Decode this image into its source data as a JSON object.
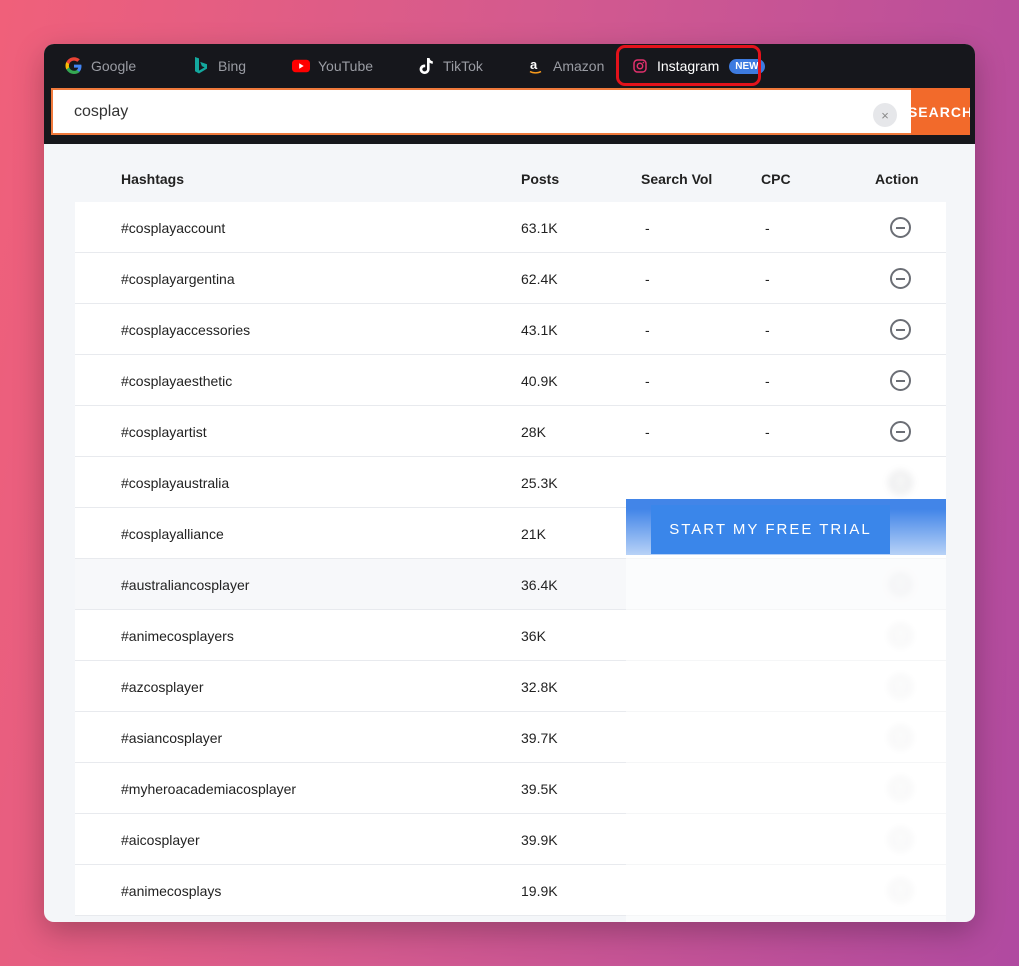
{
  "tabs": [
    {
      "label": "Google",
      "icon": "google-icon"
    },
    {
      "label": "Bing",
      "icon": "bing-icon"
    },
    {
      "label": "YouTube",
      "icon": "youtube-icon"
    },
    {
      "label": "TikTok",
      "icon": "tiktok-icon"
    },
    {
      "label": "Amazon",
      "icon": "amazon-icon"
    },
    {
      "label": "Instagram",
      "icon": "instagram-icon",
      "badge": "NEW",
      "active": true
    }
  ],
  "search": {
    "value": "cosplay",
    "button_label": "SEARCH",
    "clear_symbol": "×"
  },
  "table": {
    "headers": {
      "hashtags": "Hashtags",
      "posts": "Posts",
      "search_vol": "Search Vol",
      "cpc": "CPC",
      "action": "Action"
    },
    "rows": [
      {
        "tag": "#cosplayaccount",
        "posts": "63.1K",
        "vol": "-",
        "cpc": "-"
      },
      {
        "tag": "#cosplayargentina",
        "posts": "62.4K",
        "vol": "-",
        "cpc": "-"
      },
      {
        "tag": "#cosplayaccessories",
        "posts": "43.1K",
        "vol": "-",
        "cpc": "-"
      },
      {
        "tag": "#cosplayaesthetic",
        "posts": "40.9K",
        "vol": "-",
        "cpc": "-"
      },
      {
        "tag": "#cosplayartist",
        "posts": "28K",
        "vol": "-",
        "cpc": "-"
      },
      {
        "tag": "#cosplayaustralia",
        "posts": "25.3K"
      },
      {
        "tag": "#cosplayalliance",
        "posts": "21K"
      },
      {
        "tag": "#australiancosplayer",
        "posts": "36.4K"
      },
      {
        "tag": "#animecosplayers",
        "posts": "36K"
      },
      {
        "tag": "#azcosplayer",
        "posts": "32.8K"
      },
      {
        "tag": "#asiancosplayer",
        "posts": "39.7K"
      },
      {
        "tag": "#myheroacademiacosplayer",
        "posts": "39.5K"
      },
      {
        "tag": "#aicosplayer",
        "posts": "39.9K"
      },
      {
        "tag": "#animecosplays",
        "posts": "19.9K"
      }
    ]
  },
  "cta": {
    "label": "START MY FREE TRIAL"
  },
  "colors": {
    "accent_orange": "#f26a2b",
    "active_ring": "#e3121b",
    "cta_blue": "#3a86ea",
    "topbar": "#16171c"
  }
}
